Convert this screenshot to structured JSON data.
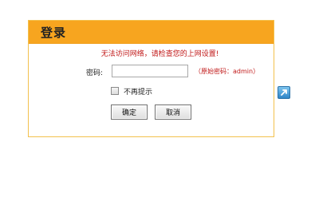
{
  "dialog": {
    "title": "登录",
    "error_message": "无法访问网络，请检查您的上网设置!",
    "password_label": "密码:",
    "password_value": "",
    "password_placeholder": "",
    "password_hint": "（原始密码：admin）",
    "remember_label": "不再提示",
    "remember_checked": false,
    "confirm_label": "确定",
    "cancel_label": "取消"
  },
  "side_icon": {
    "name": "expand-arrow-icon"
  },
  "colors": {
    "header": "#f7a51f",
    "border": "#f3c14d",
    "error_text": "#c01818",
    "icon_blue": "#2f86c8"
  }
}
